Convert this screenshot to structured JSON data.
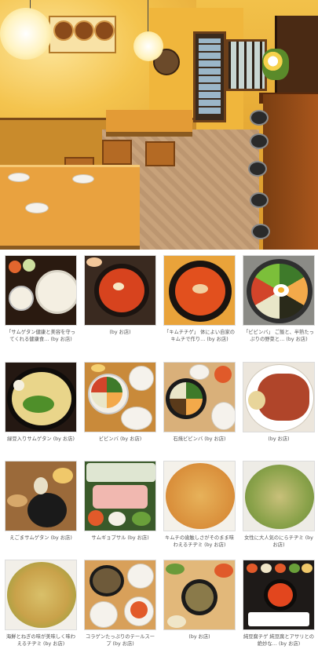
{
  "hero": {
    "image": "restaurant-interior-photo"
  },
  "thumbnails": [
    {
      "caption": "「サムゲタン健康と美容を守ってくれる健康食… (by お店)"
    },
    {
      "caption": "(by お店)"
    },
    {
      "caption": "「キムチチゲ」 体によい自家のキムチで作り… (by お店)"
    },
    {
      "caption": "「ビビンバ」 ご飯と、半熟たっぷりの野菜と… (by お店)"
    },
    {
      "caption": "緑豆入りサムゲタン (by お店)"
    },
    {
      "caption": "ビビンバ (by お店)"
    },
    {
      "caption": "石焼ビビンバ (by お店)"
    },
    {
      "caption": "(by お店)"
    },
    {
      "caption": "えごまサムゲタン (by お店)"
    },
    {
      "caption": "サムギョプサル (by お店)"
    },
    {
      "caption": "キムチの歯触しさがそのまま味わえるチヂミ (by お店)"
    },
    {
      "caption": "女性に大人気のにらチヂミ (by お店)"
    },
    {
      "caption": "海鮮とねぎの味が美味しく味わえるチヂミ (by お店)"
    },
    {
      "caption": "コラゲンたっぷりのテールスープ (by お店)"
    },
    {
      "caption": "(by お店)"
    },
    {
      "caption": "純豆腐チゲ 純豆腐とアサリとの絶妙な… (by お店)"
    }
  ],
  "colors": {
    "wall": "#f2c14a",
    "table": "#e9a23f",
    "counter": "#7a3e12",
    "caption_text": "#555555"
  }
}
